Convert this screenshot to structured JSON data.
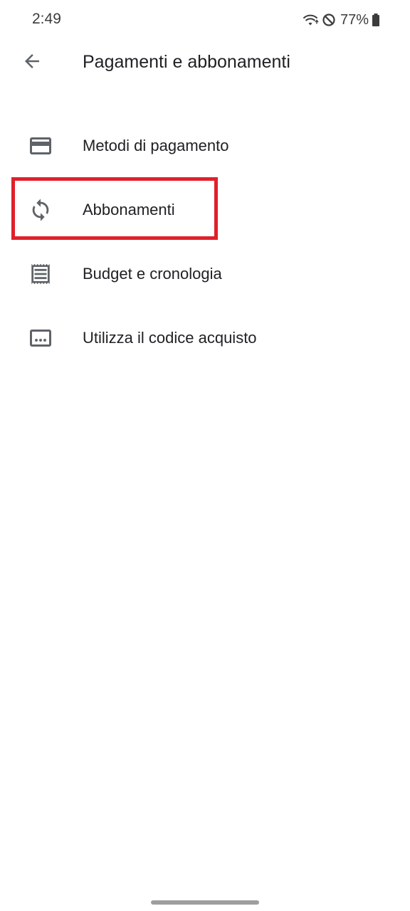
{
  "status_bar": {
    "time": "2:49",
    "battery_percent": "77%",
    "icons": [
      "wifi-icon",
      "do-not-disturb-icon",
      "battery-icon"
    ]
  },
  "app_bar": {
    "back_icon": "arrow-back-icon",
    "title": "Pagamenti e abbonamenti"
  },
  "menu": {
    "items": [
      {
        "icon": "credit-card-icon",
        "label": "Metodi di pagamento"
      },
      {
        "icon": "sync-icon",
        "label": "Abbonamenti",
        "highlighted": true
      },
      {
        "icon": "receipt-icon",
        "label": "Budget e cronologia"
      },
      {
        "icon": "redeem-code-icon",
        "label": "Utilizza il codice acquisto"
      }
    ]
  },
  "colors": {
    "highlight": "#e0202b",
    "icon": "#5f6368",
    "text": "#202124"
  }
}
